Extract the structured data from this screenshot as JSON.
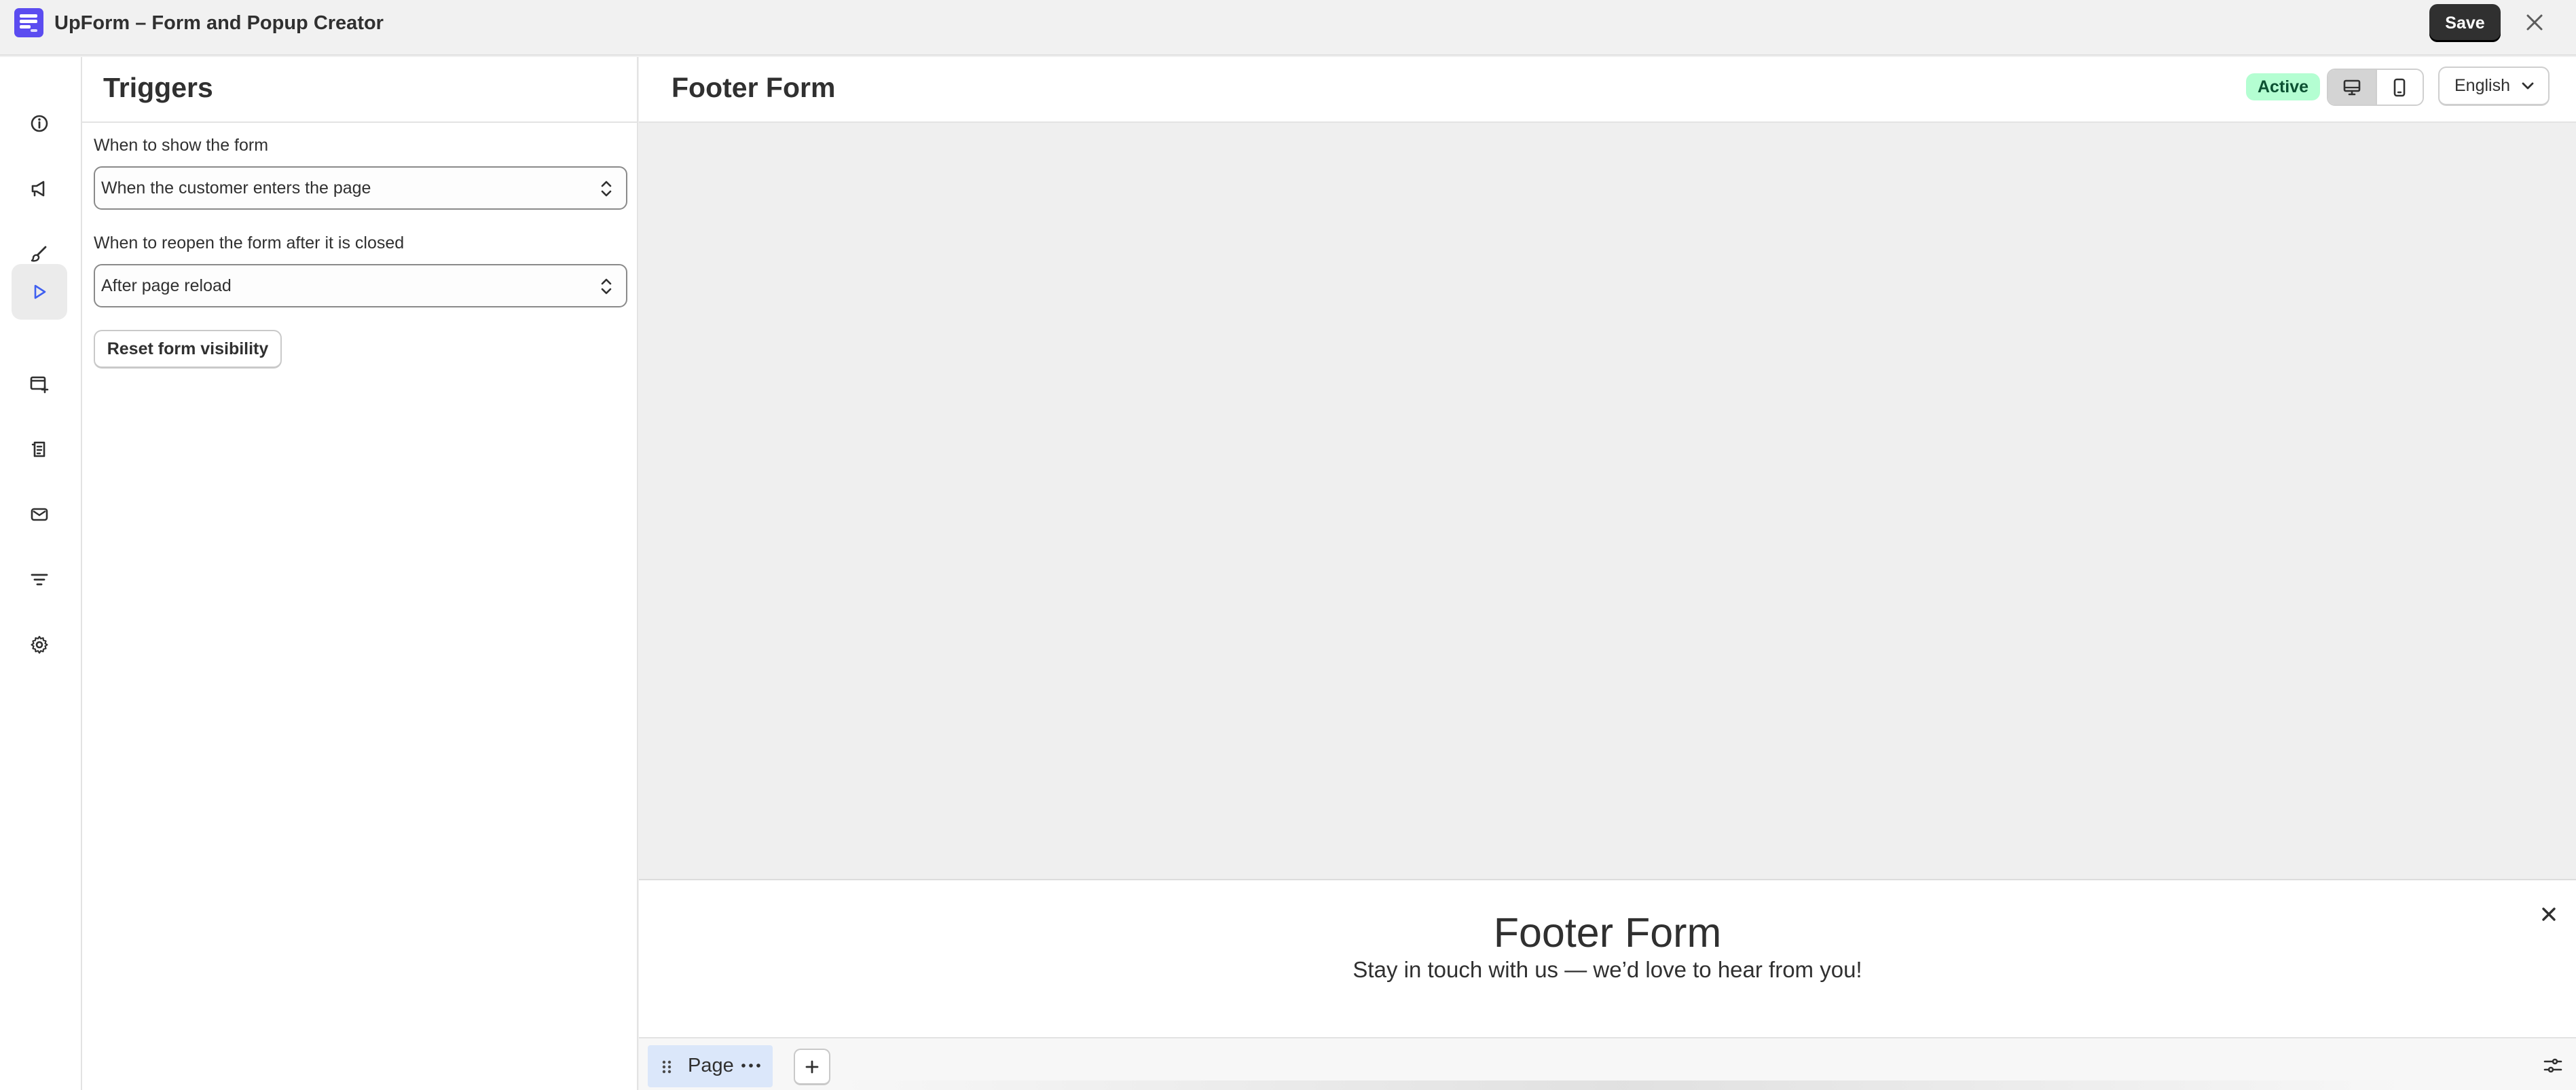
{
  "app": {
    "title": "UpForm – Form and Popup Creator",
    "save_label": "Save",
    "brand_color": "#5b4cf0"
  },
  "rail": {
    "items": [
      {
        "icon": "info-icon",
        "active": false
      },
      {
        "icon": "megaphone-icon",
        "active": false
      },
      {
        "icon": "brush-icon",
        "active": false
      },
      {
        "icon": "play-icon",
        "active": true
      },
      {
        "icon": "window-add-icon",
        "active": false
      },
      {
        "icon": "receipt-icon",
        "active": false
      },
      {
        "icon": "mail-icon",
        "active": false
      },
      {
        "icon": "filter-icon",
        "active": false
      },
      {
        "icon": "gear-icon",
        "active": false
      }
    ]
  },
  "panel": {
    "title": "Triggers",
    "show_label": "When to show the form",
    "show_value": "When the customer enters the page",
    "reopen_label": "When to reopen the form after it is closed",
    "reopen_value": "After page reload",
    "reset_label": "Reset form visibility"
  },
  "preview": {
    "form_name": "Footer Form",
    "status": "Active",
    "status_color": "#b4fed2",
    "language": "English",
    "device_selected": "desktop"
  },
  "footer_form": {
    "title": "Footer Form",
    "subtitle": "Stay in touch with us — we’d love to hear from you!"
  },
  "bottom_bar": {
    "page_label": "Page"
  }
}
